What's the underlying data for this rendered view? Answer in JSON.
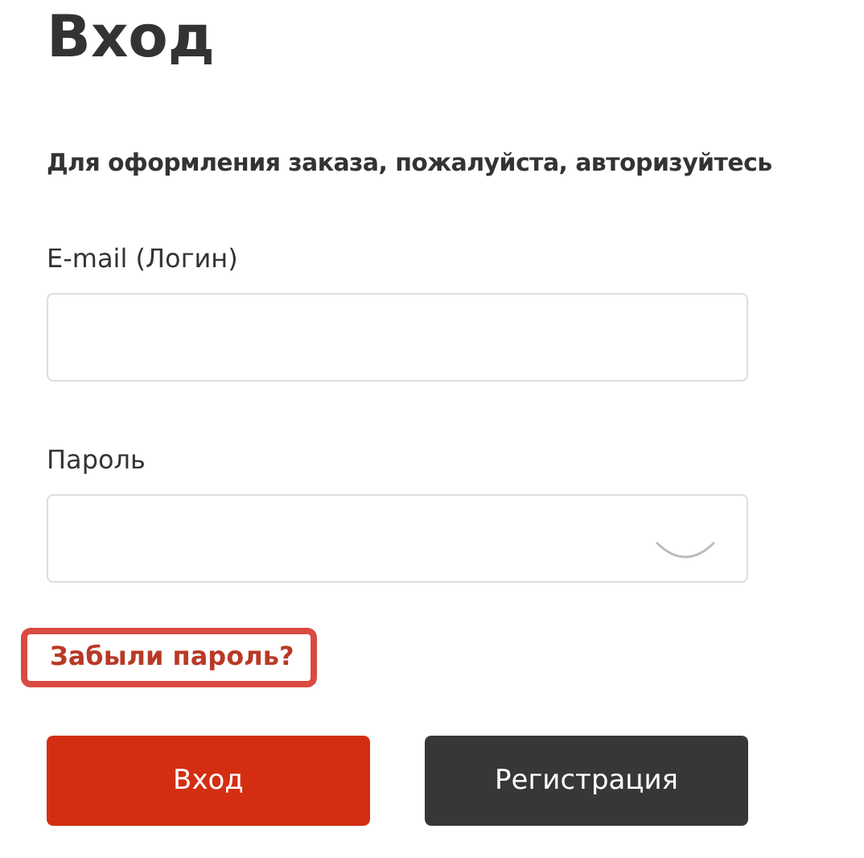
{
  "title": "Вход",
  "subtitle": "Для оформления заказа, пожалуйста, авторизуйтесь",
  "fields": [
    {
      "label": "E-mail (Логин)",
      "kind": "text"
    },
    {
      "label": "Пароль",
      "kind": "password"
    }
  ],
  "forgot_link": {
    "label": "Забыли пароль?",
    "highlighted": true
  },
  "buttons": [
    {
      "label": "Вход",
      "kind": "primary"
    },
    {
      "label": "Регистрация",
      "kind": "secondary"
    }
  ]
}
